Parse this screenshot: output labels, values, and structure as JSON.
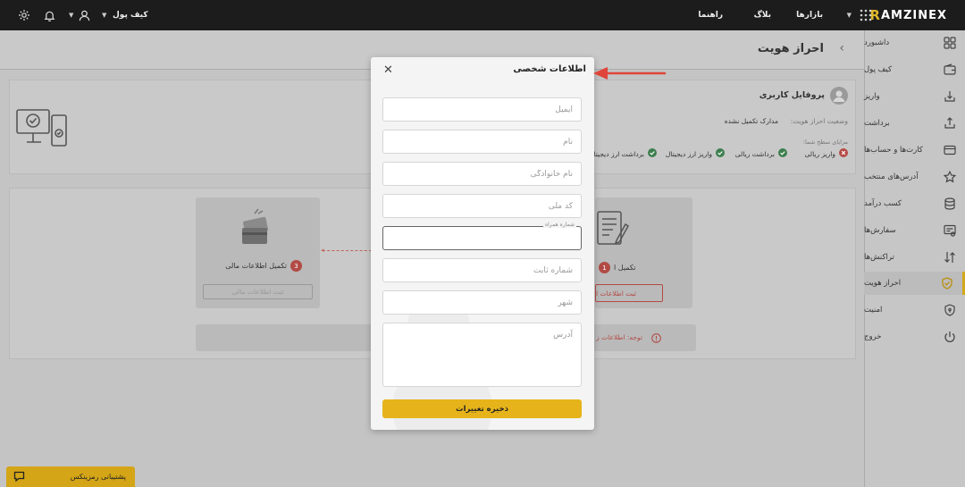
{
  "topbar": {
    "logo_initial": "R",
    "logo_rest": "AMZINEX",
    "nav_markets": "بازارها",
    "nav_blog": "بلاگ",
    "nav_guide": "راهنما",
    "wallet_label": "کیف پول"
  },
  "page": {
    "title": "احراز هویت",
    "profile_title": "پروفایل کاربری",
    "status_label": "وضعیت احراز هویت:",
    "status_value": "مدارک تکمیل نشده",
    "benefits_label": "مزایای سطح شما:",
    "benefits": [
      {
        "label": "واریز ریالی",
        "ok": false
      },
      {
        "label": "برداشت ریالی",
        "ok": true
      },
      {
        "label": "واریز ارز دیجیتال",
        "ok": true
      },
      {
        "label": "برداشت ارز دیجیتال",
        "ok": true
      }
    ],
    "step3_label": "تکمیل اطلاعات مالی",
    "step3_num": "3",
    "step3_button": "ثبت اطلاعات مالی",
    "step1_label": "تکمیل ا",
    "step1_num": "1",
    "step1_button": "ثبت اطلاعات ا",
    "notice_text": "توجه: اطلاعات ز"
  },
  "sidebar": {
    "items": [
      {
        "label": "داشبورد",
        "icon": "dashboard-icon"
      },
      {
        "label": "کیف پول",
        "icon": "wallet-icon"
      },
      {
        "label": "واریز",
        "icon": "deposit-icon"
      },
      {
        "label": "برداشت",
        "icon": "withdraw-icon"
      },
      {
        "label": "کارت‌ها و حساب‌ها",
        "icon": "card-icon"
      },
      {
        "label": "آدرس‌های منتخب",
        "icon": "star-icon"
      },
      {
        "label": "کسب درآمد",
        "icon": "database-icon"
      },
      {
        "label": "سفارش‌ها",
        "icon": "orders-icon"
      },
      {
        "label": "تراکنش‌ها",
        "icon": "transactions-icon"
      },
      {
        "label": "احراز هویت",
        "icon": "shield-check-icon",
        "active": true
      },
      {
        "label": "امنیت",
        "icon": "shield-icon"
      },
      {
        "label": "خروج",
        "icon": "power-icon"
      }
    ]
  },
  "modal": {
    "title": "اطلاعات شخصی",
    "email_placeholder": "ایمیل",
    "first_name_placeholder": "نام",
    "last_name_placeholder": "نام خانوادگی",
    "national_code_placeholder": "کد ملی",
    "mobile_label": "شماره همراه",
    "mobile_value": "",
    "phone_placeholder": "شماره ثابت",
    "city_placeholder": "شهر",
    "address_placeholder": "آدرس",
    "save_label": "ذخیره تغییرات"
  },
  "support": {
    "label": "پشتیبانی رمزینکس"
  },
  "colors": {
    "accent": "#e6b41a",
    "topbar": "#1c1c1c",
    "arrow": "#e0453a",
    "error": "#d9534f",
    "success": "#3aa55d"
  }
}
